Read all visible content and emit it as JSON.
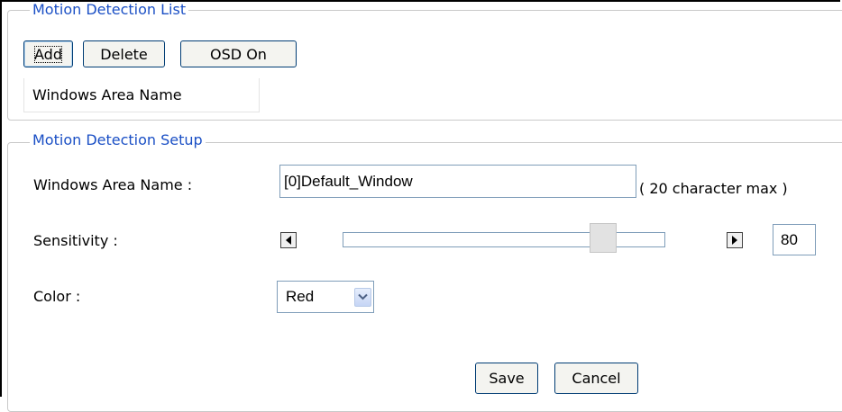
{
  "list_section": {
    "legend": "Motion Detection List",
    "buttons": {
      "add": "Add",
      "delete": "Delete",
      "osd": "OSD On"
    },
    "column_header": "Windows Area Name"
  },
  "setup_section": {
    "legend": "Motion Detection Setup",
    "name_label": "Windows Area Name :",
    "name_value": "[0]Default_Window",
    "name_hint": "( 20 character max )",
    "sensitivity_label": "Sensitivity :",
    "sensitivity_value": "80",
    "sensitivity_level": 80,
    "color_label": "Color :",
    "color_selected": "Red",
    "save_label": "Save",
    "cancel_label": "Cancel"
  },
  "icons": {
    "slider_decrease": "left-arrow-icon",
    "slider_increase": "right-arrow-icon",
    "dropdown": "chevron-down-icon"
  },
  "colors": {
    "legend_text": "#1a4fc5",
    "button_border": "#003c74",
    "input_border": "#7f9db9"
  }
}
